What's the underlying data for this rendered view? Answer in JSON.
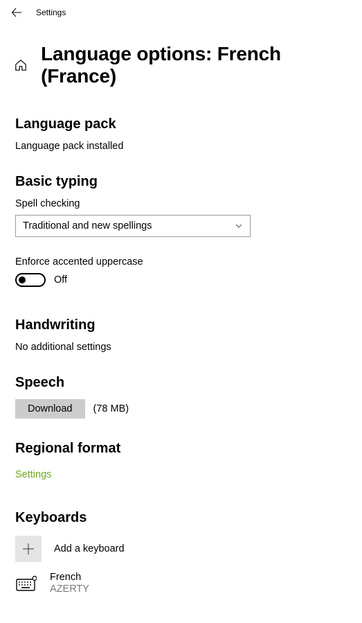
{
  "top": {
    "label": "Settings"
  },
  "page": {
    "title": "Language options: French (France)"
  },
  "languagePack": {
    "heading": "Language pack",
    "status": "Language pack installed"
  },
  "basicTyping": {
    "heading": "Basic typing",
    "spellCheckLabel": "Spell checking",
    "spellCheckValue": "Traditional and new spellings",
    "enforceLabel": "Enforce accented uppercase",
    "toggleState": "Off"
  },
  "handwriting": {
    "heading": "Handwriting",
    "text": "No additional settings"
  },
  "speech": {
    "heading": "Speech",
    "buttonLabel": "Download",
    "size": "(78 MB)"
  },
  "regionalFormat": {
    "heading": "Regional format",
    "linkLabel": "Settings"
  },
  "keyboards": {
    "heading": "Keyboards",
    "addLabel": "Add a keyboard",
    "items": [
      {
        "name": "French",
        "layout": "AZERTY"
      }
    ]
  }
}
